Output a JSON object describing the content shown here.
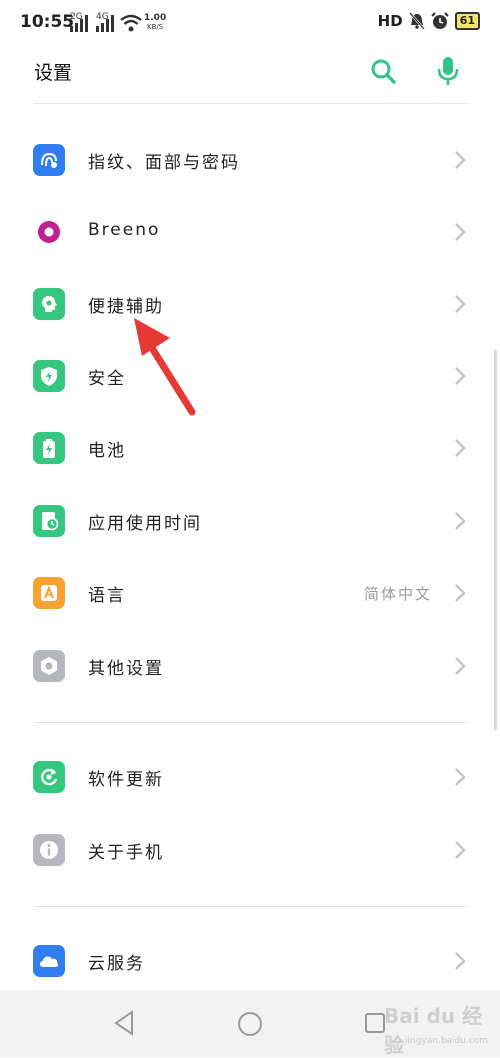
{
  "status_bar": {
    "time": "10:55",
    "net_1": "2G",
    "net_2": "4G",
    "speed_value": "1.00",
    "speed_unit": "KB/S",
    "hd": "HD",
    "battery": "61"
  },
  "header": {
    "title": "设置",
    "search_icon": "search-icon",
    "mic_icon": "microphone-icon",
    "accent_color": "#2fc58a"
  },
  "settings": {
    "items": [
      {
        "label": "指纹、面部与密码",
        "icon": "fingerprint-icon",
        "color": "#2f7df0"
      },
      {
        "label": "Breeno",
        "icon": "breeno-icon",
        "color": "#c21f8f"
      },
      {
        "label": "便捷辅助",
        "icon": "assist-icon",
        "color": "#35c67f"
      },
      {
        "label": "安全",
        "icon": "shield-icon",
        "color": "#35c67f"
      },
      {
        "label": "电池",
        "icon": "battery-icon",
        "color": "#35c67f"
      },
      {
        "label": "应用使用时间",
        "icon": "screen-time-icon",
        "color": "#35c67f"
      },
      {
        "label": "语言",
        "icon": "language-icon",
        "color": "#f7a332",
        "value": "简体中文"
      },
      {
        "label": "其他设置",
        "icon": "other-settings-icon",
        "color": "#b4b8be"
      },
      {
        "label": "软件更新",
        "icon": "update-icon",
        "color": "#35c67f"
      },
      {
        "label": "关于手机",
        "icon": "info-icon",
        "color": "#b4b8be"
      },
      {
        "label": "云服务",
        "icon": "cloud-icon",
        "color": "#2f7df0"
      }
    ]
  },
  "watermark": {
    "text": "Bai du 经验",
    "sub": "jingyan.baidu.com"
  }
}
